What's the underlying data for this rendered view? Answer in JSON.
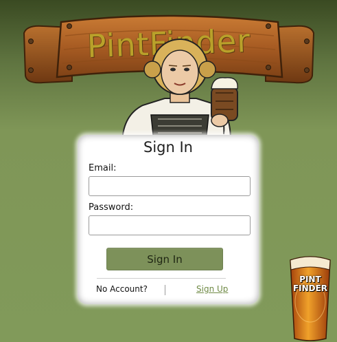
{
  "brand": {
    "title": "PintFinder"
  },
  "signin": {
    "title": "Sign In",
    "email_label": "Email:",
    "email_value": "",
    "password_label": "Password:",
    "password_value": "",
    "submit_label": "Sign In",
    "no_account_text": "No Account?",
    "signup_label": "Sign Up"
  },
  "pint_logo": {
    "line1": "PINT",
    "line2": "FINDER"
  },
  "colors": {
    "accent": "#7d915a",
    "link": "#6f8a45",
    "background": "#819a5a",
    "wood": "#b46a2c",
    "brand_text": "#b9a12a"
  },
  "icons": [
    "wooden-banner-graphic",
    "beer-maid-mascot",
    "pint-glass-logo"
  ]
}
